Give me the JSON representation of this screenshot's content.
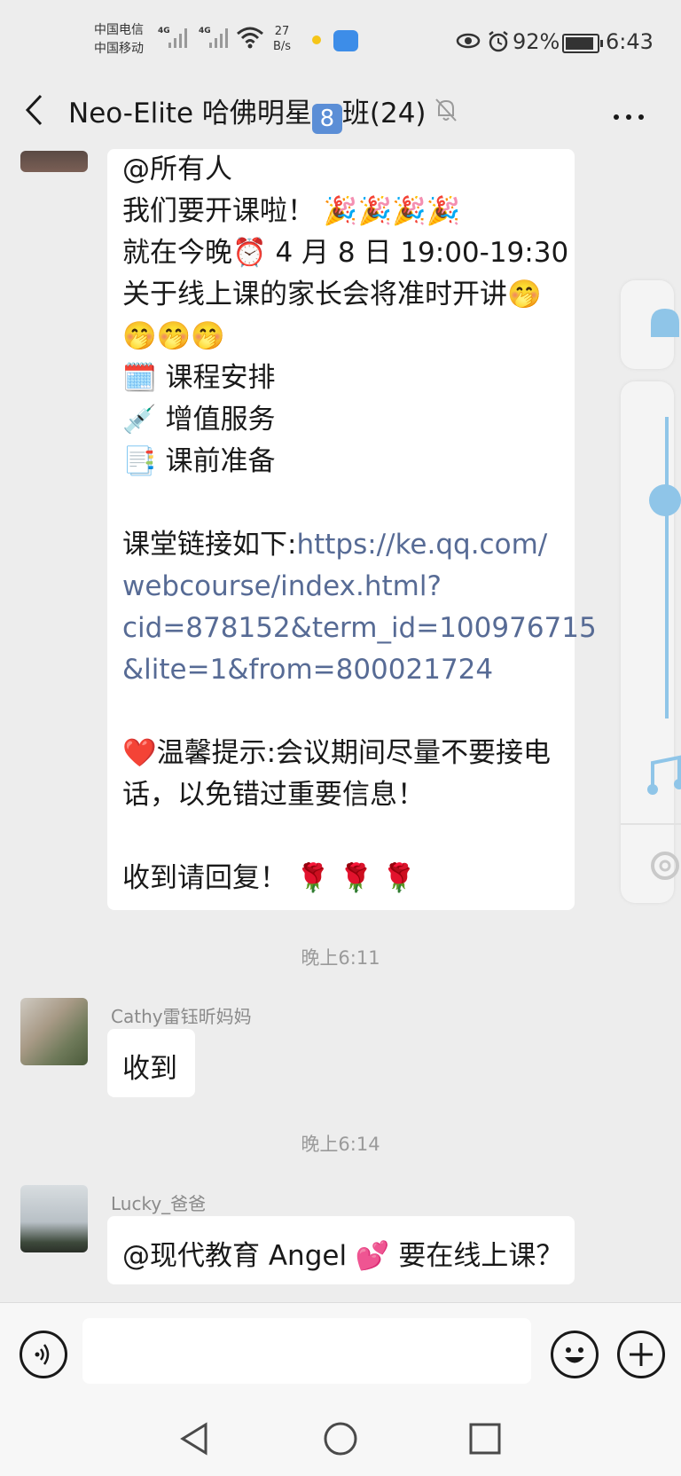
{
  "status_bar": {
    "carrier_1": "中国电信",
    "carrier_2": "中国移动",
    "network_1": "4G",
    "network_2": "4G",
    "speed_value": "27",
    "speed_unit": "B/s",
    "battery": "92%",
    "time": "6:43",
    "icons": [
      "signal-icon",
      "wifi-icon",
      "sun-icon",
      "app-notification-icon",
      "eye-icon",
      "alarm-icon",
      "battery-icon"
    ]
  },
  "header": {
    "title_prefix": "Neo-Elite 哈佛明星",
    "title_badge": "8",
    "title_suffix": "班(24)",
    "icons": [
      "back-icon",
      "mute-bell-icon",
      "more-icon"
    ]
  },
  "messages": {
    "announcement": {
      "lines": [
        "@所有人",
        "我们要开课啦！ 🎉🎉🎉🎉",
        "就在今晚⏰ 4 月 8 日 19:00-19:30",
        "关于线上课的家长会将准时开讲🤭",
        "🤭🤭🤭",
        "🗓️ 课程安排",
        "💉 增值服务",
        "📑 课前准备",
        "",
        "课堂链接如下:",
        "",
        "",
        "",
        "",
        "❤️温馨提示:会议期间尽量不要接电",
        "话，以免错过重要信息！",
        "",
        "收到请回复！ 🌹 🌹 🌹"
      ],
      "link_lines": [
        "https://ke.qq.com/",
        "webcourse/index.html?",
        "cid=878152&term_id=100976715",
        "&lite=1&from=800021724"
      ]
    },
    "time_1": "晚上6:11",
    "reply_1": {
      "sender": "Cathy雷钰昕妈妈",
      "text": "收到"
    },
    "time_2": "晚上6:14",
    "reply_2": {
      "sender": "Lucky_爸爸",
      "text": "@现代教育 Angel 💕  要在线上课？"
    }
  },
  "input_bar": {
    "icons": [
      "voice-icon",
      "emoji-icon",
      "add-icon"
    ],
    "text": ""
  },
  "nav_bar": {
    "icons": [
      "nav-back-icon",
      "nav-home-icon",
      "nav-recent-icon"
    ]
  },
  "side_panel": {
    "icons": [
      "bell-icon",
      "slider-handle",
      "music-icon",
      "settings-icon"
    ]
  },
  "colors": {
    "background": "#ededed",
    "bubble": "#ffffff",
    "link": "#576b95",
    "time_text": "#9a9a9a"
  }
}
